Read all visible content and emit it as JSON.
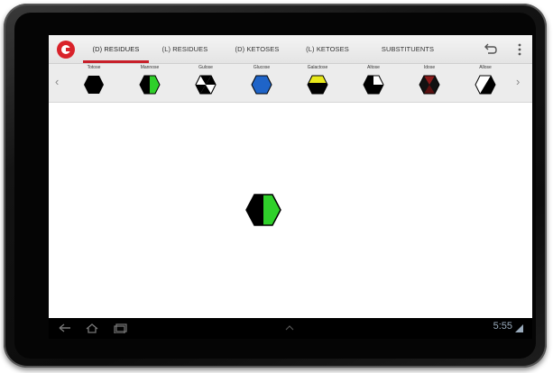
{
  "action_bar": {
    "tabs": [
      {
        "label": "(D) RESIDUES",
        "active": true
      },
      {
        "label": "(L) RESIDUES",
        "active": false
      },
      {
        "label": "(D) KETOSES",
        "active": false
      },
      {
        "label": "(L) KETOSES",
        "active": false
      },
      {
        "label": "SUBSTITUENTS",
        "active": false
      }
    ],
    "logo_icon": "app-logo-icon",
    "undo_icon": "undo-icon",
    "overflow_icon": "overflow-menu-icon",
    "accent_color": "#c8202a"
  },
  "residue_strip": {
    "prev_arrow": "‹",
    "next_arrow": "›",
    "items": [
      {
        "label": "Totose",
        "glyph": "solid-black"
      },
      {
        "label": "Mannose",
        "glyph": "black-green-half"
      },
      {
        "label": "Gulose",
        "glyph": "hourglass"
      },
      {
        "label": "Glucose",
        "glyph": "solid-blue"
      },
      {
        "label": "Galactose",
        "glyph": "yellow-top-band"
      },
      {
        "label": "Altose",
        "glyph": "white-top-right"
      },
      {
        "label": "Idose",
        "glyph": "dark-red-cross"
      },
      {
        "label": "Allose",
        "glyph": "white-diagonal"
      }
    ]
  },
  "canvas": {
    "selected_glyph": "black-green-half",
    "colors": {
      "green": "#2fd02a",
      "blue": "#1f64c8",
      "yellow": "#e8e81a",
      "red": "#8b1a1a"
    }
  },
  "status_bar": {
    "time": "5:55",
    "back_icon": "back-icon",
    "home_icon": "home-icon",
    "recents_icon": "recent-apps-icon",
    "menu_icon": "menu-up-icon"
  }
}
